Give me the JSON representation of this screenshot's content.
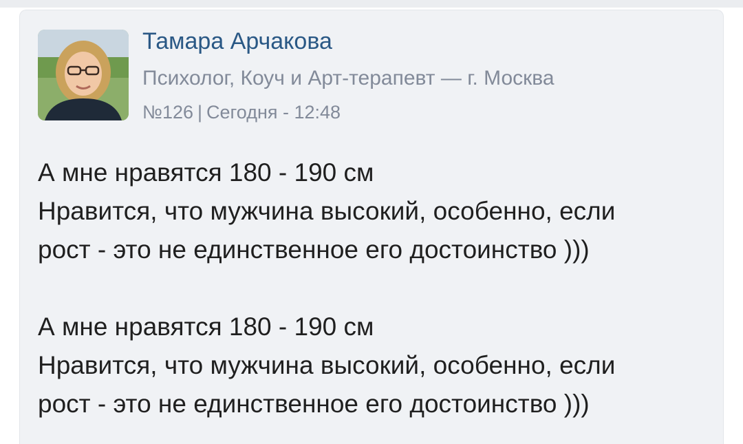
{
  "post": {
    "author": "Тамара Арчакова",
    "subtitle": "Психолог, Коуч и Арт-терапевт — г. Москва",
    "number": "№126",
    "separator": "|",
    "date": "Сегодня - 12:48",
    "avatar_icon": "user-photo",
    "paragraphs": [
      {
        "line1": "А мне нравятся 180 - 190 см",
        "line2": "Нравится, что мужчина высокий, особенно, если",
        "line3": "рост - это не единственное его достоинство )))"
      },
      {
        "line1": "А мне нравятся 180 - 190 см",
        "line2": "Нравится, что мужчина высокий, особенно, если",
        "line3": "рост - это не единственное его достоинство )))"
      }
    ]
  },
  "colors": {
    "author": "#2a5885",
    "secondary": "#828a99",
    "text": "#1f1f1f",
    "card_bg": "#f0f2f5"
  }
}
